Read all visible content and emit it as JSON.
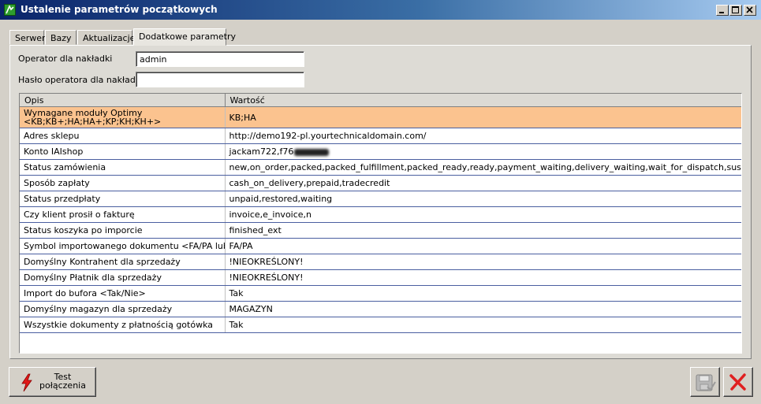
{
  "window": {
    "title": "Ustalenie parametrów początkowych"
  },
  "tabs": [
    "Serwer",
    "Bazy",
    "Aktualizacje",
    "Dodatkowe parametry"
  ],
  "form": {
    "operator_label": "Operator dla nakładki",
    "operator_value": "admin",
    "password_label": "Hasło operatora dla nakładki",
    "password_value": ""
  },
  "table": {
    "headers": [
      "Opis",
      "Wartość"
    ],
    "rows": [
      {
        "opis": "Wymagane moduły Optimy <KB;KB+;HA;HA+;KP;KH;KH+>",
        "wartosc": "KB;HA"
      },
      {
        "opis": "Adres sklepu",
        "wartosc": "http://demo192-pl.yourtechnicaldomain.com/"
      },
      {
        "opis": "Konto IAIshop",
        "wartosc": "jackam722,f76"
      },
      {
        "opis": "Status zamówienia",
        "wartosc": "new,on_order,packed,packed_fulfillment,packed_ready,ready,payment_waiting,delivery_waiting,wait_for_dispatch,suspended"
      },
      {
        "opis": "Sposób zapłaty",
        "wartosc": "cash_on_delivery,prepaid,tradecredit"
      },
      {
        "opis": "Status przedpłaty",
        "wartosc": "unpaid,restored,waiting"
      },
      {
        "opis": "Czy klient prosił o fakturę",
        "wartosc": "invoice,e_invoice,n"
      },
      {
        "opis": "Status koszyka po imporcie",
        "wartosc": "finished_ext"
      },
      {
        "opis": "Symbol importowanego dokumentu <FA/PA lub RO>",
        "wartosc": "FA/PA"
      },
      {
        "opis": "Domyślny Kontrahent dla sprzedaży",
        "wartosc": "!NIEOKREŚLONY!"
      },
      {
        "opis": "Domyślny Płatnik dla sprzedaży",
        "wartosc": "!NIEOKREŚLONY!"
      },
      {
        "opis": "Import do bufora <Tak/Nie>",
        "wartosc": "Tak"
      },
      {
        "opis": "Domyślny magazyn dla sprzedaży",
        "wartosc": "MAGAZYN"
      },
      {
        "opis": "Wszystkie dokumenty z płatnością gotówka",
        "wartosc": "Tak"
      }
    ]
  },
  "buttons": {
    "test_connection_line1": "Test",
    "test_connection_line2": "połączenia"
  },
  "colors": {
    "title_gradient_start": "#0a246a",
    "selected_row": "#fbc38f",
    "row_line": "#4a5fa0",
    "close_red": "#e02020"
  },
  "icons": {
    "app": "app-icon",
    "minimize": "minimize-icon",
    "maximize": "maximize-icon",
    "close": "close-icon",
    "test": "lightning-icon",
    "save": "save-disk-icon",
    "cancel": "red-x-icon"
  }
}
